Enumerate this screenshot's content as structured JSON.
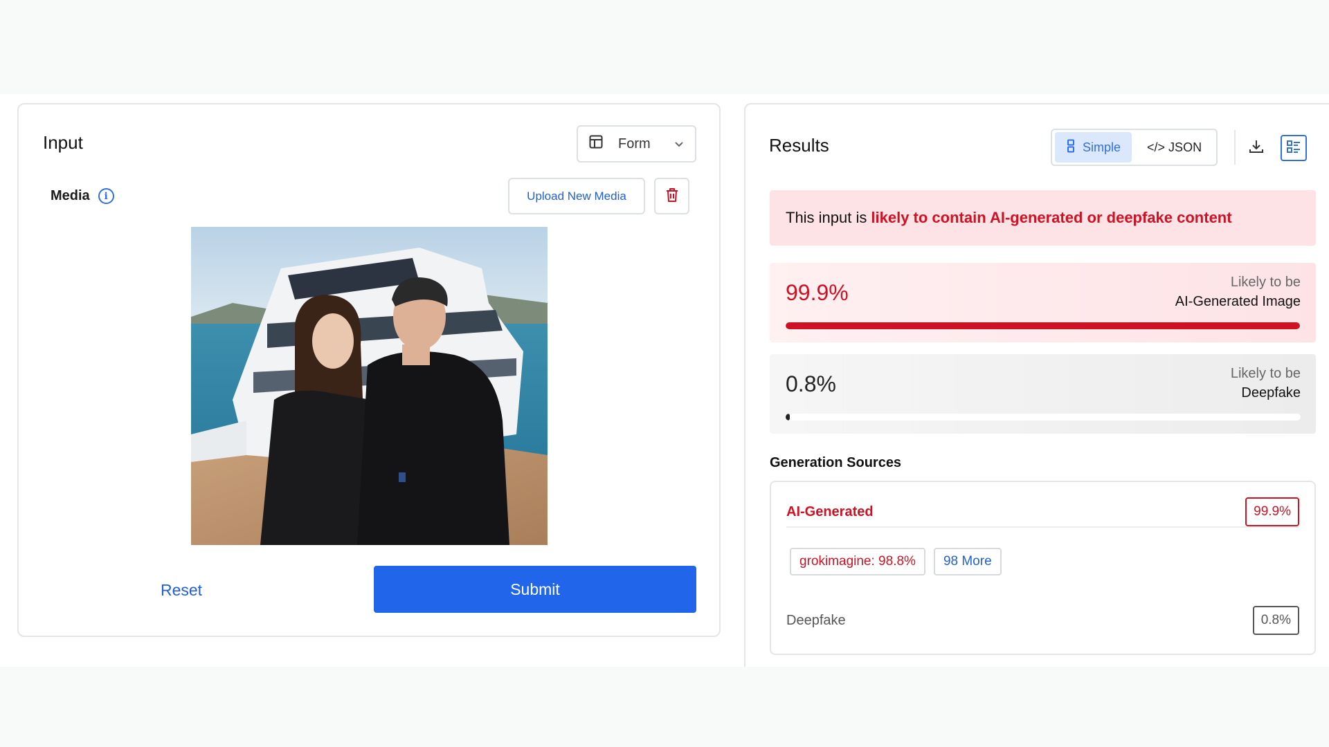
{
  "input": {
    "title": "Input",
    "mode_select": "Form",
    "media_label": "Media",
    "upload_label": "Upload New Media",
    "reset_label": "Reset",
    "submit_label": "Submit"
  },
  "results": {
    "title": "Results",
    "view_simple": "Simple",
    "view_json": "</> JSON",
    "alert_prefix": "This input is",
    "alert_highlight": "likely to contain AI-generated or deepfake content",
    "scores": [
      {
        "value": "99.9%",
        "fraction": 0.999,
        "line1": "Likely to be",
        "line2": "AI-Generated Image"
      },
      {
        "value": "0.8%",
        "fraction": 0.008,
        "line1": "Likely to be",
        "line2": "Deepfake"
      }
    ],
    "sources_title": "Generation Sources",
    "sources": {
      "ai_label": "AI-Generated",
      "ai_value": "99.9%",
      "tags": [
        "grokimagine: 98.8%",
        "98 More"
      ],
      "deepfake_label": "Deepfake",
      "deepfake_value": "0.8%"
    }
  },
  "colors": {
    "accent_blue": "#2166ea",
    "alert_red": "#cf1124"
  }
}
